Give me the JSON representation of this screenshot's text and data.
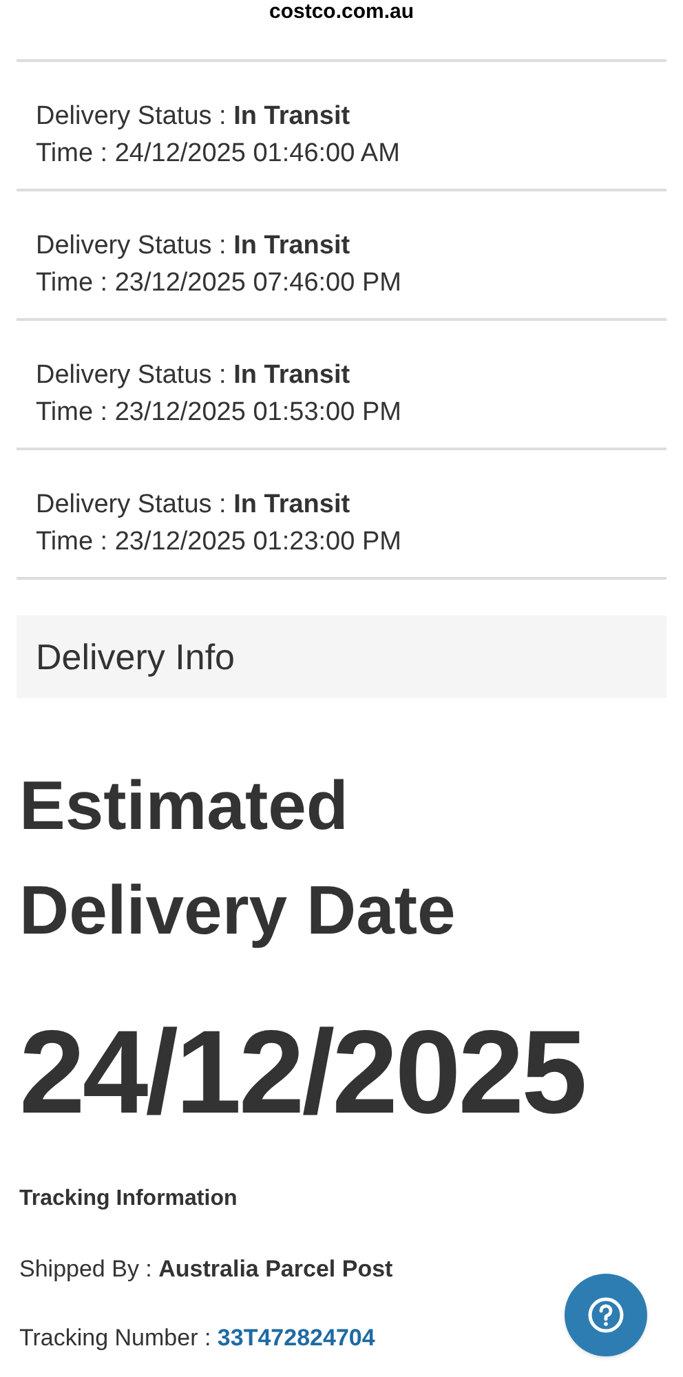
{
  "address_bar": {
    "domain": "costco.com.au"
  },
  "events": [
    {
      "status": "Delivery Status : **In Transit**",
      "time": "Time : 24/12/2025 01:46:00 AM"
    },
    {
      "status": "Delivery Status : **In Transit**",
      "time": "Time : 23/12/2025 07:46:00 PM"
    },
    {
      "status": "Delivery Status : **In Transit**",
      "time": "Time : 23/12/2025 01:53:00 PM"
    },
    {
      "status": "Delivery Status : **In Transit**",
      "time": "Time : 23/12/2025 01:23:00 PM"
    }
  ],
  "delivery_info": {
    "heading": "Delivery Info",
    "estimated_label": "Estimated Delivery Date",
    "estimated_date": "24/12/2025"
  },
  "tracking": {
    "heading": "Tracking Information",
    "shipped_by": "Shipped By : **Australia Parcel Post**",
    "number_label": "Tracking Number : ",
    "number": "33T472824704"
  }
}
